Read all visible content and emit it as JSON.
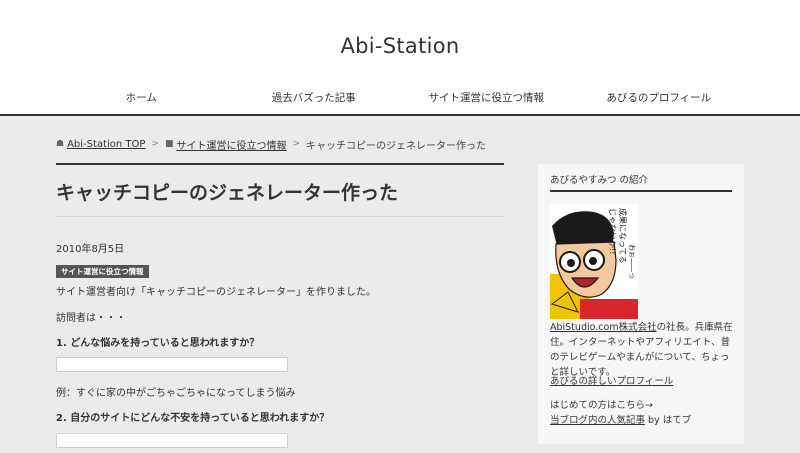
{
  "site": {
    "title": "Abi-Station"
  },
  "nav": {
    "items": [
      {
        "label": "ホーム"
      },
      {
        "label": "過去バズった記事"
      },
      {
        "label": "サイト運営に役立つ情報"
      },
      {
        "label": "あびるのプロフィール"
      }
    ]
  },
  "breadcrumb": {
    "home": "Abi-Station TOP",
    "category": "サイト運営に役立つ情報",
    "current": "キャッチコピーのジェネレーター作った"
  },
  "article": {
    "title": "キャッチコピーのジェネレーター作った",
    "date": "2010年8月5日",
    "category_tag": "サイト運営に役立つ情報",
    "intro": "サイト運営者向け「キャッチコピーのジェネレーター」を作りました。",
    "visitor_label": "訪問者は・・・",
    "q1": "1. どんな悩みを持っていると思われますか？",
    "q1_input_value": "",
    "example1": "例：すぐに家の中がごちゃごちゃになってしまう悩み",
    "q2": "2. 自分のサイトにどんな不安を持っていると思われますか？",
    "q2_input_value": ""
  },
  "sidebar": {
    "widget_title": "あびるやすみつ の紹介",
    "comic_text_1": "成果になってる",
    "comic_text_2": "じゃないか!!",
    "comic_text_3": "おぉ――っ",
    "bio_company": "AbiStudio.com株式会社",
    "bio_rest": "の社長。兵庫県在住。インターネットやアフィリエイト、昔のテレビゲームやまんがについて、ちょっと詳しいです。",
    "profile_link": "あびるの詳しいプロフィール",
    "first_time": "はじめての方はこちら→",
    "popular_link": "当ブログ内の人気記事",
    "popular_suffix": " by はてブ"
  },
  "colors": {
    "background": "#ebebeb",
    "header": "#ffffff",
    "accent": "#333333",
    "tag": "#555555"
  }
}
